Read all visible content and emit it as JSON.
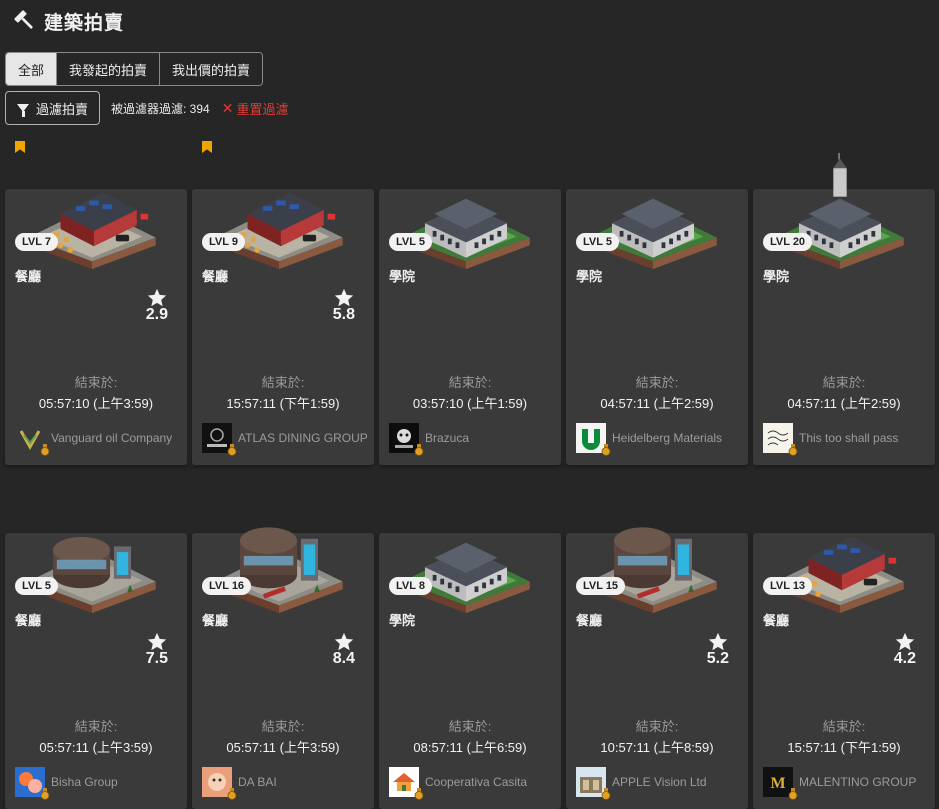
{
  "header": {
    "title": "建築拍賣",
    "icon": "hammer-icon"
  },
  "tabs": [
    {
      "label": "全部",
      "active": true
    },
    {
      "label": "我發起的拍賣",
      "active": false
    },
    {
      "label": "我出價的拍賣",
      "active": false
    }
  ],
  "filter": {
    "button_label": "過濾拍賣",
    "count_text": "被過濾器過濾: 394",
    "reset_label": "重置過濾",
    "reset_color": "#e53935"
  },
  "ends_label": "結束於:",
  "cards": [
    {
      "level": "LVL 7",
      "type": "餐廳",
      "rating": "2.9",
      "bookmarked": true,
      "building": "restaurant-small",
      "end_time": "05:57:10 (上午3:59)",
      "owner": "Vanguard oil Company",
      "logo": "vanguard"
    },
    {
      "level": "LVL 9",
      "type": "餐廳",
      "rating": "5.8",
      "bookmarked": true,
      "building": "restaurant-small",
      "end_time": "15:57:11 (下午1:59)",
      "owner": "ATLAS DINING GROUP",
      "logo": "atlas"
    },
    {
      "level": "LVL 5",
      "type": "學院",
      "rating": "",
      "bookmarked": false,
      "building": "academy-small",
      "end_time": "03:57:10 (上午1:59)",
      "owner": "Brazuca",
      "logo": "brazuca"
    },
    {
      "level": "LVL 5",
      "type": "學院",
      "rating": "",
      "bookmarked": false,
      "building": "academy-small",
      "end_time": "04:57:11 (上午2:59)",
      "owner": "Heidelberg Materials",
      "logo": "heidelberg"
    },
    {
      "level": "LVL 20",
      "type": "學院",
      "rating": "",
      "bookmarked": false,
      "building": "academy-tower",
      "end_time": "04:57:11 (上午2:59)",
      "owner": "This too shall pass",
      "logo": "thistoo"
    },
    {
      "level": "LVL 5",
      "type": "餐廳",
      "rating": "7.5",
      "bookmarked": false,
      "building": "restaurant-round",
      "end_time": "05:57:11 (上午3:59)",
      "owner": "Bisha Group",
      "logo": "bisha"
    },
    {
      "level": "LVL 16",
      "type": "餐廳",
      "rating": "8.4",
      "bookmarked": false,
      "building": "restaurant-round-big",
      "end_time": "05:57:11 (上午3:59)",
      "owner": "DA BAI",
      "logo": "dabai"
    },
    {
      "level": "LVL 8",
      "type": "學院",
      "rating": "",
      "bookmarked": false,
      "building": "academy-small",
      "end_time": "08:57:11 (上午6:59)",
      "owner": "Cooperativa Casita",
      "logo": "casita"
    },
    {
      "level": "LVL 15",
      "type": "餐廳",
      "rating": "5.2",
      "bookmarked": false,
      "building": "restaurant-round-big",
      "end_time": "10:57:11 (上午8:59)",
      "owner": "APPLE Vision Ltd",
      "logo": "apple"
    },
    {
      "level": "LVL 13",
      "type": "餐廳",
      "rating": "4.2",
      "bookmarked": false,
      "building": "restaurant-small",
      "end_time": "15:57:11 (下午1:59)",
      "owner": "MALENTINO GROUP",
      "logo": "malentino"
    }
  ],
  "colors": {
    "background": "#262626",
    "card": "#3a3a3a",
    "bookmark": "#f0a500",
    "medal": "#e0a020"
  }
}
